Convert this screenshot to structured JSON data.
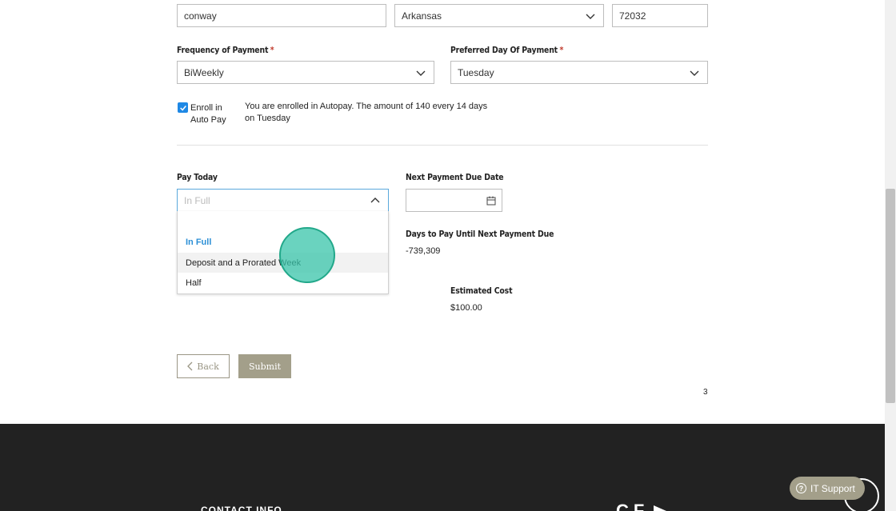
{
  "address": {
    "city_value": "conway",
    "state_value": "Arkansas",
    "zip_value": "72032"
  },
  "frequency": {
    "label": "Frequency of Payment",
    "required": "*",
    "value": "BiWeekly"
  },
  "preferred_day": {
    "label": "Preferred Day Of Payment",
    "required": "*",
    "value": "Tuesday"
  },
  "autopay": {
    "checkbox_label_line1": "Enroll in",
    "checkbox_label_line2": "Auto Pay",
    "checked": true,
    "message_line1": "You are enrolled in Autopay. The amount of 140 every 14 days",
    "message_line2": "on Tuesday"
  },
  "pay_today": {
    "label": "Pay Today",
    "placeholder": "In Full",
    "options": [
      "In Full",
      "Deposit and a Prorated Week",
      "Half"
    ]
  },
  "next_due": {
    "label": "Next Payment Due Date",
    "value": ""
  },
  "days_to_pay": {
    "label": "Days to Pay Until Next Payment Due",
    "value": "-739,309"
  },
  "estimated_cost": {
    "label": "Estimated Cost",
    "value": "$100.00"
  },
  "actions": {
    "back_label": "Back",
    "submit_label": "Submit"
  },
  "page_number": "3",
  "footer": {
    "contact_heading": "CONTACT INFO",
    "logo_text": "CF",
    "support_label": "IT Support"
  },
  "colors": {
    "accent_blue": "#2b8fd6",
    "button_khaki": "#a39f8a",
    "footer_bg": "#222222",
    "required_red": "#c0392b"
  }
}
